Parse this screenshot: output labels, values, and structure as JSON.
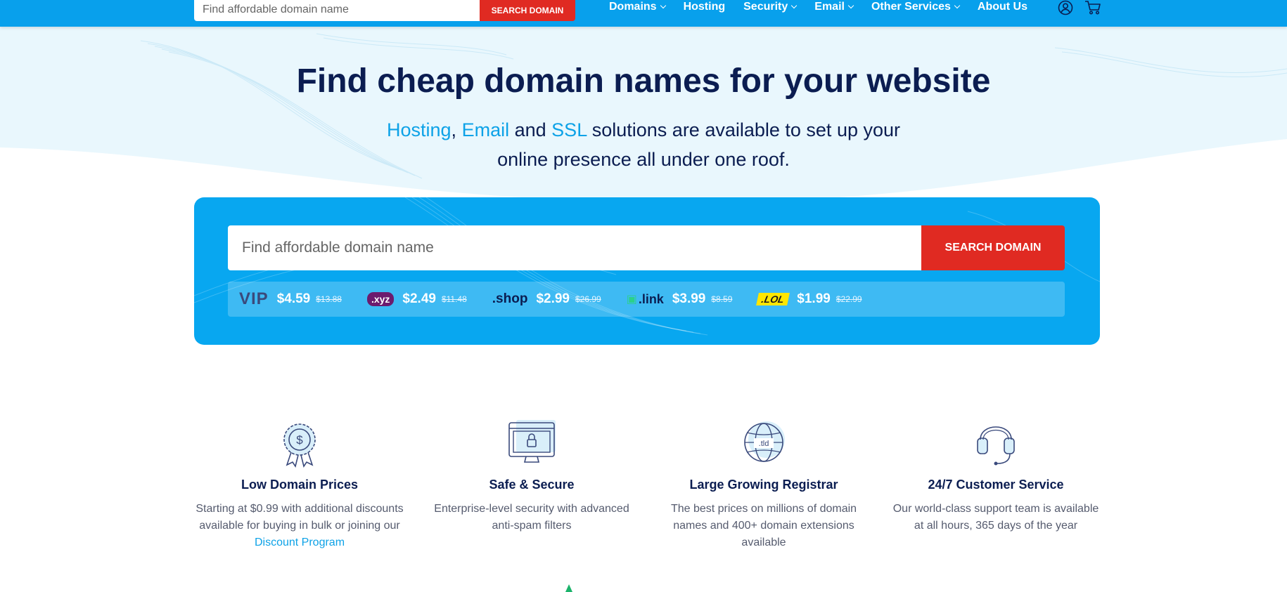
{
  "topbar": {
    "search_placeholder": "Find affordable domain name",
    "search_button": "SEARCH DOMAIN",
    "nav": [
      {
        "label": "Domains",
        "dropdown": true
      },
      {
        "label": "Hosting",
        "dropdown": false
      },
      {
        "label": "Security",
        "dropdown": true
      },
      {
        "label": "Email",
        "dropdown": true
      },
      {
        "label": "Other Services",
        "dropdown": true
      },
      {
        "label": "About Us",
        "dropdown": false
      }
    ],
    "icons": [
      "user-icon",
      "cart-icon"
    ]
  },
  "hero": {
    "title": "Find cheap domain names for your website",
    "sub_hosting": "Hosting",
    "sub_comma": ",",
    "sub_email": "Email",
    "sub_and": "and",
    "sub_ssl": "SSL",
    "sub_rest": "solutions are available to set up your",
    "sub_line2": "online presence all under one roof."
  },
  "search": {
    "placeholder": "Find affordable domain name",
    "button": "SEARCH DOMAIN"
  },
  "tlds": [
    {
      "logo": "VIP",
      "price": "$4.59",
      "old_price": "$13.88",
      "color": "#3a4a7c"
    },
    {
      "logo": ".xyz",
      "price": "$2.49",
      "old_price": "$11.48",
      "color": "#6c1b6e"
    },
    {
      "logo": ".shop",
      "price": "$2.99",
      "old_price": "$26.99",
      "color": "#0b1d51"
    },
    {
      "logo": ".link",
      "price": "$3.99",
      "old_price": "$8.59",
      "color": "#0b1d51"
    },
    {
      "logo": ".LOL",
      "price": "$1.99",
      "old_price": "$22.99",
      "color": "#ffe600"
    }
  ],
  "features": [
    {
      "icon": "dollar-award-icon",
      "title": "Low Domain Prices",
      "desc": "Starting at $0.99 with additional discounts available for buying in bulk or joining our",
      "link": "Discount Program"
    },
    {
      "icon": "secure-browser-icon",
      "title": "Safe & Secure",
      "desc": "Enterprise-level security with advanced anti-spam filters",
      "link": ""
    },
    {
      "icon": "tld-globe-icon",
      "title": "Large Growing Registrar",
      "desc": "The best prices on millions of domain names and 400+ domain extensions available",
      "link": "",
      "icon_text": ".tld"
    },
    {
      "icon": "headset-icon",
      "title": "24/7 Customer Service",
      "desc": "Our world-class support team is available at all hours, 365 days of the year",
      "link": ""
    }
  ],
  "colors": {
    "primary": "#08a0ec",
    "accent_red": "#e02a22",
    "heading": "#0b1d51",
    "link": "#0da2e7"
  }
}
